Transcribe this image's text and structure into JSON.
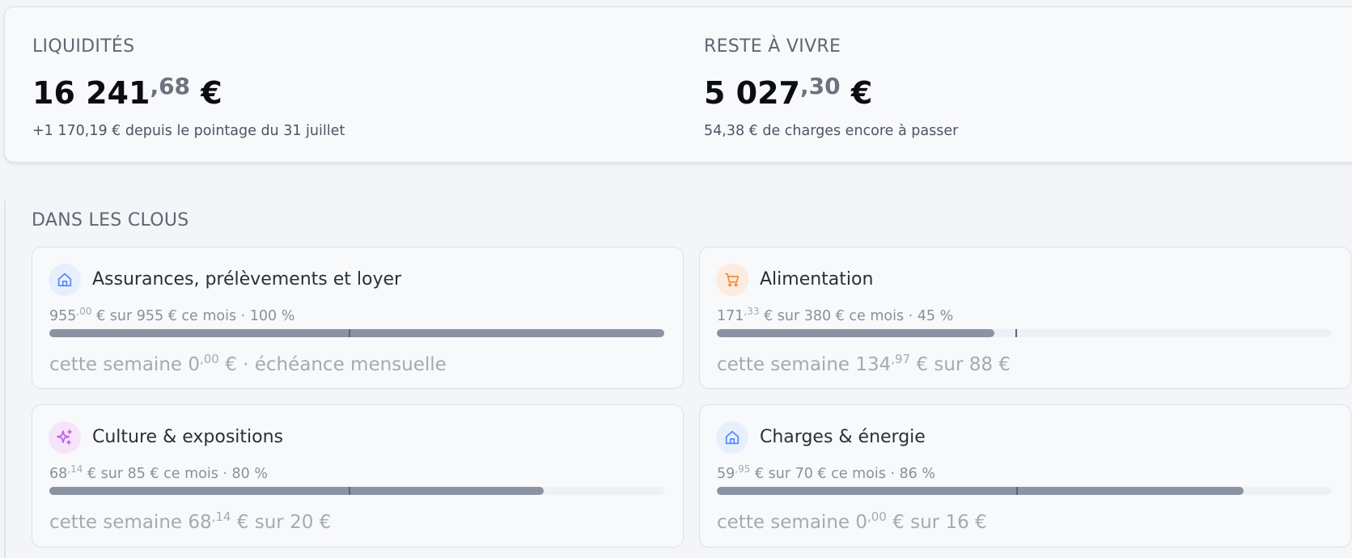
{
  "summary": {
    "liquidites": {
      "label": "LIQUIDITÉS",
      "amount_int": "16 241",
      "amount_cents": ",68",
      "currency": "€",
      "subtitle": "+1 170,19 € depuis le pointage du 31 juillet"
    },
    "reste": {
      "label": "RESTE À VIVRE",
      "amount_int": "5 027",
      "amount_cents": ",30",
      "currency": "€",
      "subtitle": "54,38 € de charges encore à passer"
    }
  },
  "section": {
    "title": "DANS LES CLOUS"
  },
  "categories": [
    {
      "title": "Assurances, prélèvements et loyer",
      "icon": "home-icon",
      "icon_color": "#4f86f7",
      "icon_bg": "#e8effc",
      "spent_int": "955",
      "spent_cents": ",00",
      "meta_rest": " € sur 955 € ce mois · 100 %",
      "progress": 1.0,
      "tick": 0.487,
      "week_prefix": "cette semaine 0",
      "week_cents": ",00",
      "week_rest": " € · échéance mensuelle"
    },
    {
      "title": "Alimentation",
      "icon": "cart-icon",
      "icon_color": "#f08a3c",
      "icon_bg": "#fcebdf",
      "spent_int": "171",
      "spent_cents": ",33",
      "meta_rest": " € sur 380 € ce mois · 45 %",
      "progress": 0.451,
      "tick": 0.485,
      "week_prefix": "cette semaine 134",
      "week_cents": ",97",
      "week_rest": " € sur 88 €"
    },
    {
      "title": "Culture & expositions",
      "icon": "sparkles-icon",
      "icon_color": "#c160ec",
      "icon_bg": "#f6e4fb",
      "spent_int": "68",
      "spent_cents": ",14",
      "meta_rest": " € sur 85 € ce mois · 80 %",
      "progress": 0.804,
      "tick": 0.487,
      "week_prefix": "cette semaine 68",
      "week_cents": ",14",
      "week_rest": " € sur 20 €"
    },
    {
      "title": "Charges & énergie",
      "icon": "home-icon",
      "icon_color": "#4f86f7",
      "icon_bg": "#e8effc",
      "spent_int": "59",
      "spent_cents": ",95",
      "meta_rest": " € sur 70 € ce mois · 86 %",
      "progress": 0.857,
      "tick": 0.487,
      "week_prefix": "cette semaine 0",
      "week_cents": ",00",
      "week_rest": " € sur 16 €"
    }
  ]
}
